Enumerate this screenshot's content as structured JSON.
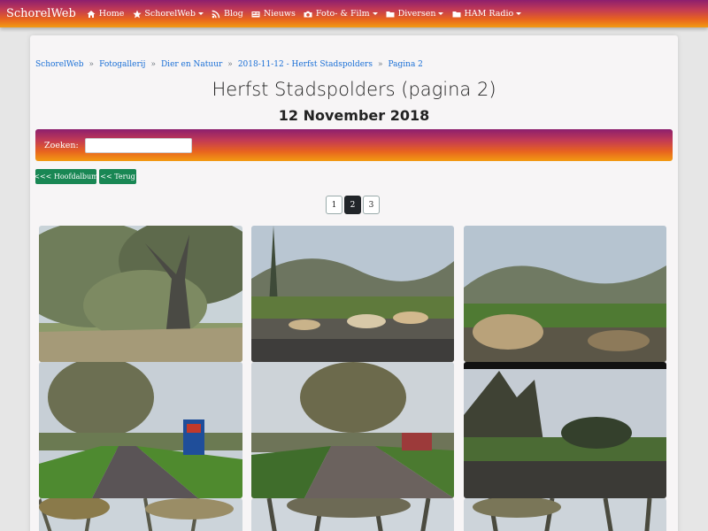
{
  "navbar": {
    "brand": "SchorelWeb",
    "items": [
      {
        "label": "Home",
        "icon": "home-icon",
        "dropdown": false
      },
      {
        "label": "SchorelWeb",
        "icon": "star-icon",
        "dropdown": true
      },
      {
        "label": "Blog",
        "icon": "rss-icon",
        "dropdown": false
      },
      {
        "label": "Nieuws",
        "icon": "newspaper-icon",
        "dropdown": false
      },
      {
        "label": "Foto- & Film",
        "icon": "camera-icon",
        "dropdown": true
      },
      {
        "label": "Diversen",
        "icon": "folder-icon",
        "dropdown": true
      },
      {
        "label": "HAM Radio",
        "icon": "folder-icon",
        "dropdown": true
      }
    ]
  },
  "breadcrumb": [
    "SchorelWeb",
    "Fotogallerij",
    "Dier en Natuur",
    "2018-11-12 - Herfst Stadspolders",
    "Pagina 2"
  ],
  "page": {
    "title": "Herfst Stadspolders (pagina 2)",
    "date": "12 November 2018"
  },
  "search": {
    "label": "Zoeken:",
    "value": ""
  },
  "buttons": {
    "main_album": "<<< Hoofdalbum",
    "back": "<< Terug"
  },
  "pagination": {
    "pages": [
      "1",
      "2",
      "3"
    ],
    "current": "2"
  },
  "colors": {
    "gradient_start": "#8c1f6e",
    "gradient_end": "#f29b12",
    "link": "#1a6fd6",
    "button_green": "#198754"
  }
}
